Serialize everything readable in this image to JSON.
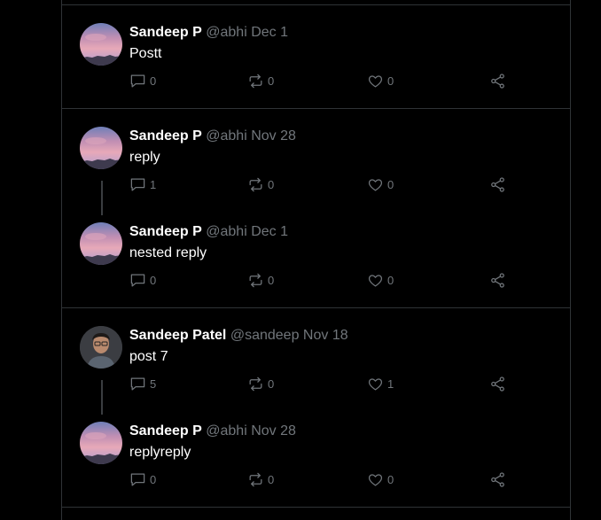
{
  "colors": {
    "background": "#000000",
    "border": "#2f3336",
    "text": "#ffffff",
    "muted": "#71767b"
  },
  "posts": [
    {
      "name": "Sandeep P",
      "handle": "@abhi",
      "date": "Dec 1",
      "text": "Postt",
      "avatar": "sunset-avatar",
      "replies": "0",
      "reposts": "0",
      "likes": "0"
    },
    {
      "name": "Sandeep P",
      "handle": "@abhi",
      "date": "Nov 28",
      "text": "reply",
      "avatar": "sunset-avatar",
      "replies": "1",
      "reposts": "0",
      "likes": "0"
    },
    {
      "name": "Sandeep P",
      "handle": "@abhi",
      "date": "Dec 1",
      "text": "nested reply",
      "avatar": "sunset-avatar",
      "replies": "0",
      "reposts": "0",
      "likes": "0"
    },
    {
      "name": "Sandeep Patel",
      "handle": "@sandeep",
      "date": "Nov 18",
      "text": "post 7",
      "avatar": "person-avatar",
      "replies": "5",
      "reposts": "0",
      "likes": "1"
    },
    {
      "name": "Sandeep P",
      "handle": "@abhi",
      "date": "Nov 28",
      "text": "replyreply",
      "avatar": "sunset-avatar",
      "replies": "0",
      "reposts": "0",
      "likes": "0"
    }
  ]
}
